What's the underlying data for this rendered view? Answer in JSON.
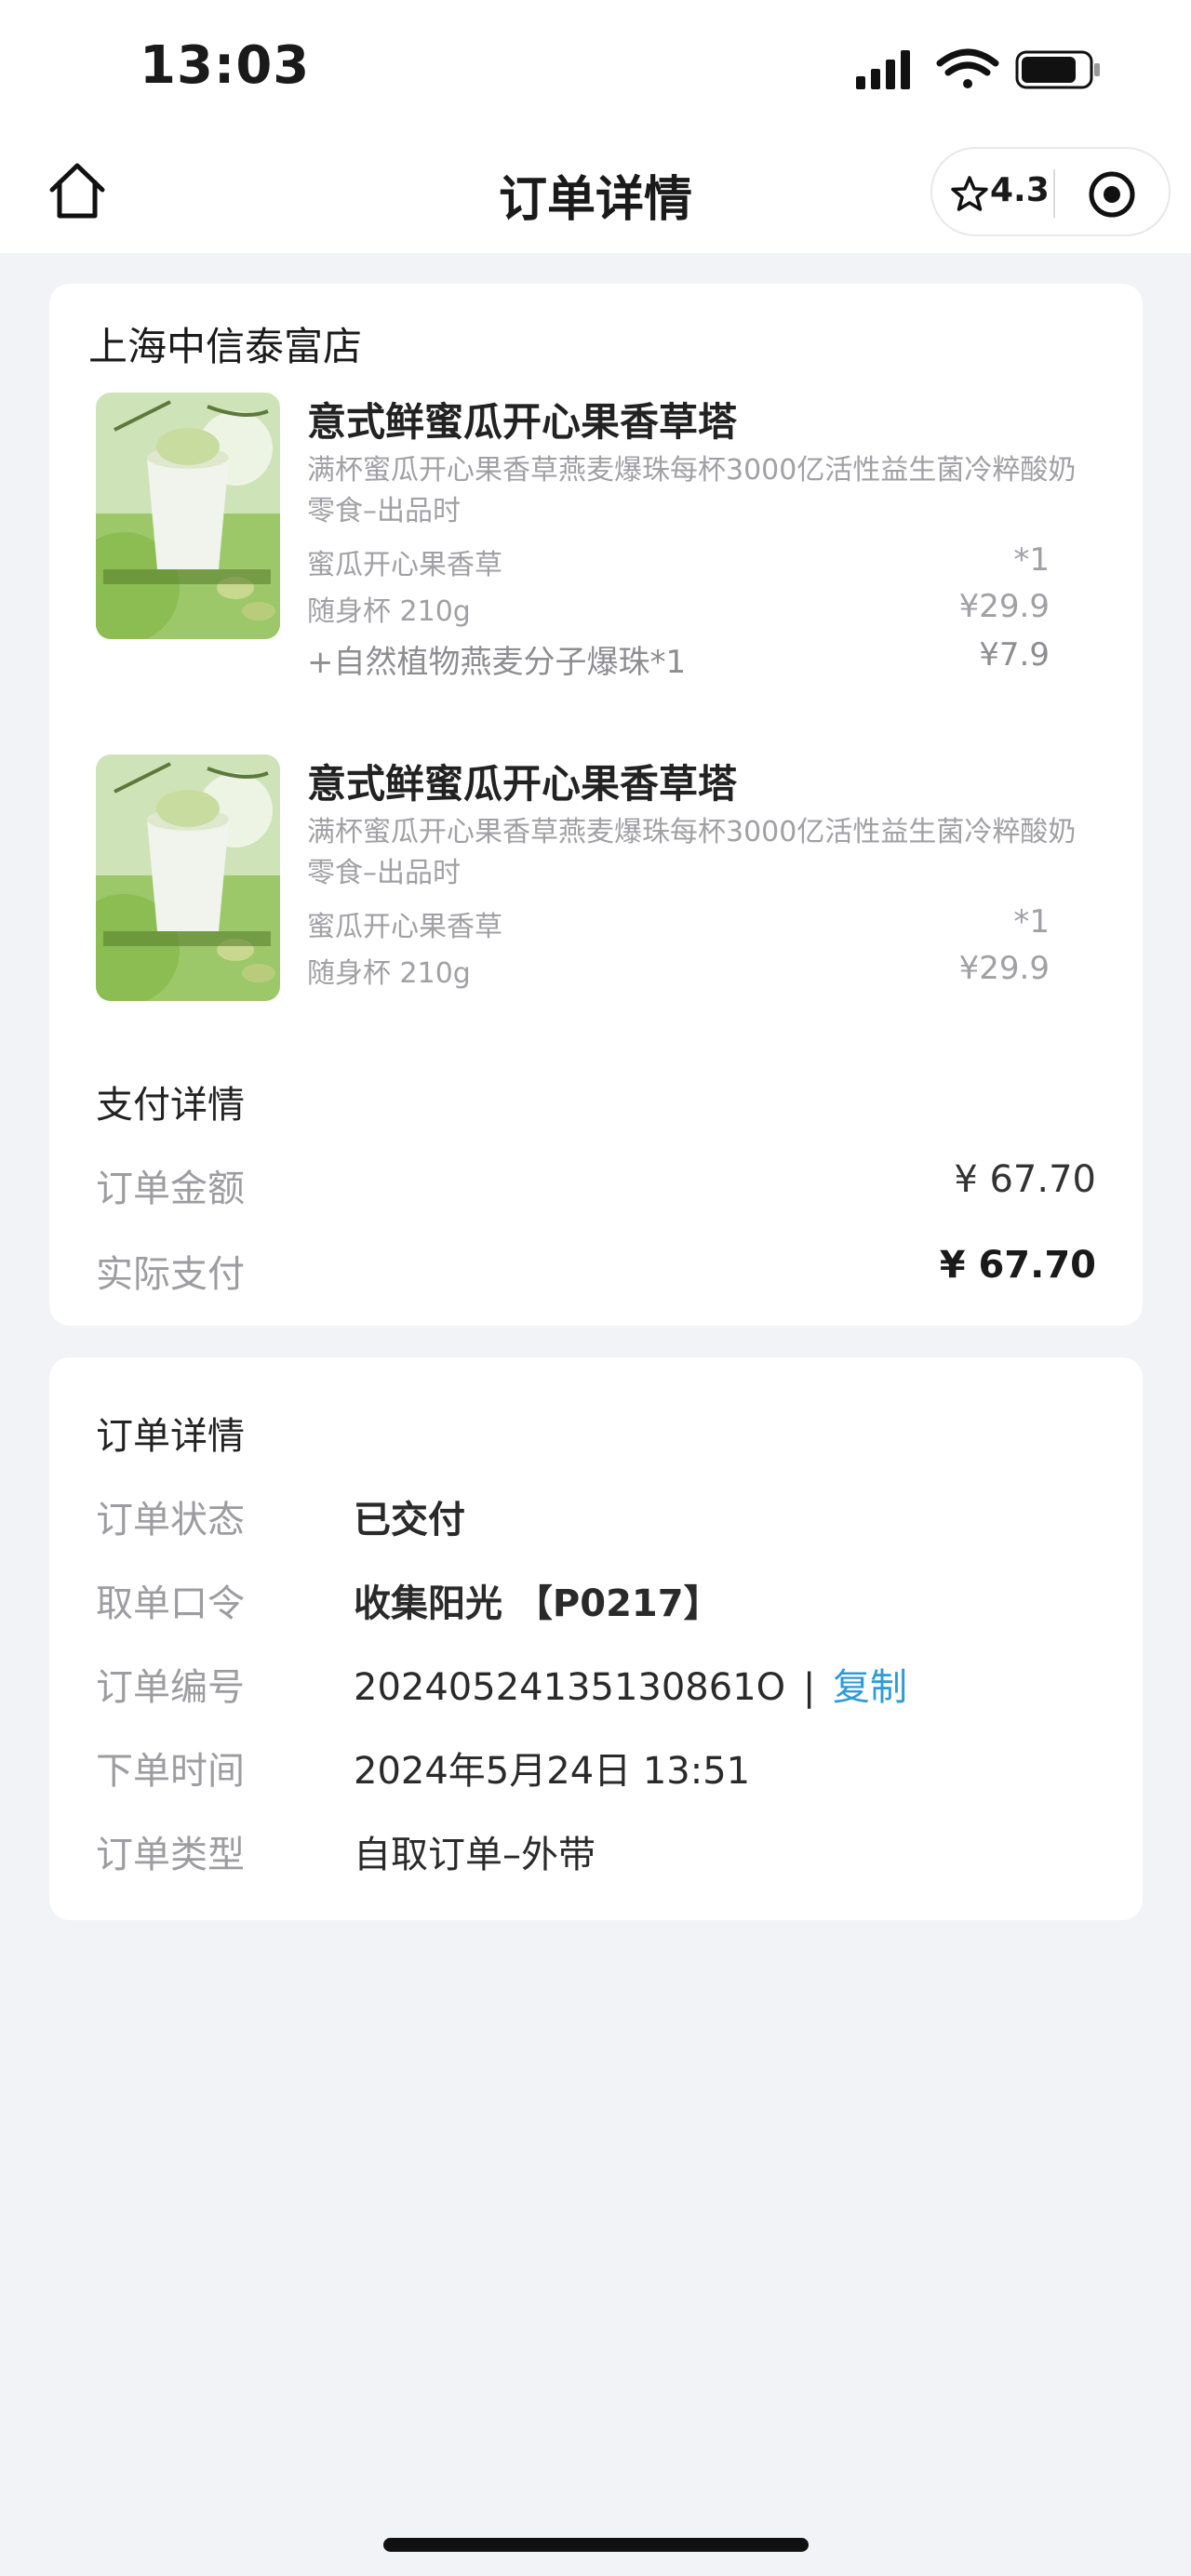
{
  "status_bar": {
    "time": "13:03"
  },
  "nav": {
    "title": "订单详情",
    "rating": "4.3"
  },
  "store": {
    "name": "上海中信泰富店"
  },
  "items": [
    {
      "name": "意式鲜蜜瓜开心果香草塔",
      "description": "满杯蜜瓜开心果香草燕麦爆珠每杯3000亿活性益生菌冷粹酸奶零食–出品时",
      "flavor": "蜜瓜开心果香草",
      "quantity": "*1",
      "cup": "随身杯 210g",
      "price": "¥29.9",
      "addon": "+自然植物燕麦分子爆珠*1",
      "addon_price": "¥7.9"
    },
    {
      "name": "意式鲜蜜瓜开心果香草塔",
      "description": "满杯蜜瓜开心果香草燕麦爆珠每杯3000亿活性益生菌冷粹酸奶零食–出品时",
      "flavor": "蜜瓜开心果香草",
      "quantity": "*1",
      "cup": "随身杯 210g",
      "price": "¥29.9"
    }
  ],
  "payment": {
    "title": "支付详情",
    "order_amount_label": "订单金额",
    "order_amount": "¥ 67.70",
    "actual_paid_label": "实际支付",
    "actual_paid": "¥ 67.70"
  },
  "order_details": {
    "title": "订单详情",
    "status_label": "订单状态",
    "status": "已交付",
    "pickup_label": "取单口令",
    "pickup_code": "收集阳光 【P0217】",
    "number_label": "订单编号",
    "number": "20240524135130861O",
    "separator": "|",
    "copy_label": "复制",
    "time_label": "下单时间",
    "time": "2024年5月24日 13:51",
    "type_label": "订单类型",
    "type": "自取订单–外带"
  },
  "colors": {
    "background": "#f2f3f7",
    "card": "#ffffff",
    "link": "#2f9bd6",
    "muted_text": "#a0a0a5"
  }
}
